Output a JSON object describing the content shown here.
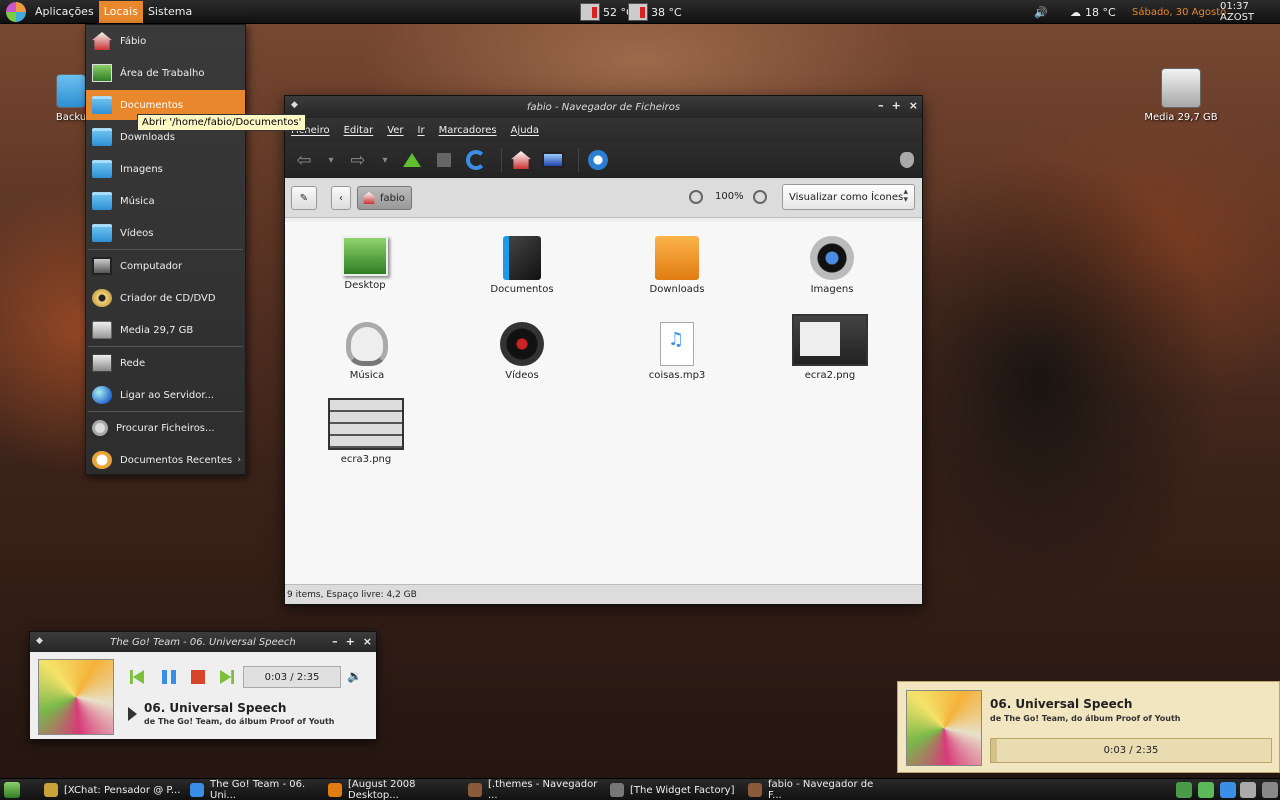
{
  "top_panel": {
    "menus": [
      "Aplicações",
      "Locais",
      "Sistema"
    ],
    "active_menu": "Locais",
    "cpu_temp": "52 °C",
    "hdd_temp": "38 °C",
    "weather": "18 °C",
    "date": "Sábado, 30 Agosto",
    "time": "01:37 AZOST"
  },
  "places_menu": {
    "items": [
      {
        "label": "Fábio",
        "icon": "home-icon"
      },
      {
        "label": "Área de Trabalho",
        "icon": "desktop-icon"
      },
      {
        "label": "Documentos",
        "icon": "folder-icon",
        "highlighted": true
      },
      {
        "label": "Downloads",
        "icon": "folder-icon"
      },
      {
        "label": "Imagens",
        "icon": "folder-icon"
      },
      {
        "label": "Música",
        "icon": "folder-icon"
      },
      {
        "label": "Vídeos",
        "icon": "folder-icon"
      },
      {
        "label": "Computador",
        "icon": "computer-icon"
      },
      {
        "label": "Criador de CD/DVD",
        "icon": "cd-icon"
      },
      {
        "label": "Media 29,7 GB",
        "icon": "drive-icon"
      },
      {
        "label": "Rede",
        "icon": "network-icon"
      },
      {
        "label": "Ligar ao Servidor...",
        "icon": "globe-icon"
      },
      {
        "label": "Procurar Ficheiros...",
        "icon": "search-icon"
      },
      {
        "label": "Documentos Recentes",
        "icon": "recent-icon",
        "submenu": true
      }
    ],
    "tooltip": "Abrir '/home/fabio/Documentos'"
  },
  "desktop_icons": {
    "left_partial": "Backu",
    "media": "Media 29,7 GB"
  },
  "file_manager": {
    "title": "fabio - Navegador de Ficheiros",
    "menubar": [
      "Ficheiro",
      "Editar",
      "Ver",
      "Ir",
      "Marcadores",
      "Ajuda"
    ],
    "location": "fabio",
    "zoom": "100%",
    "view_mode": "Visualizar como Ícones",
    "files": [
      {
        "name": "Desktop",
        "kind": "t-desk"
      },
      {
        "name": "Documentos",
        "kind": "t-docs"
      },
      {
        "name": "Downloads",
        "kind": "t-down"
      },
      {
        "name": "Imagens",
        "kind": "t-img"
      },
      {
        "name": "Música",
        "kind": "t-music"
      },
      {
        "name": "Vídeos",
        "kind": "t-video"
      },
      {
        "name": "coisas.mp3",
        "kind": "t-mp3"
      },
      {
        "name": "ecra2.png",
        "kind": "t-shot"
      },
      {
        "name": "ecra3.png",
        "kind": "t-shot2"
      }
    ],
    "status": "9 items, Espaço livre: 4,2 GB"
  },
  "music_player": {
    "title": "The Go! Team - 06. Universal Speech",
    "time": "0:03 / 2:35",
    "song": "06. Universal Speech",
    "subtitle": "de The Go! Team, do álbum Proof of Youth"
  },
  "notification": {
    "song": "06. Universal Speech",
    "subtitle": "de The Go! Team, do álbum Proof of Youth",
    "time": "0:03 / 2:35",
    "progress": 0.02
  },
  "taskbar": [
    {
      "label": "[XChat: Pensador @ P...",
      "color": "#c9a23a"
    },
    {
      "label": "The Go! Team - 06. Uni...",
      "color": "#3a8ee6"
    },
    {
      "label": "[August 2008 Desktop...",
      "color": "#e07c12"
    },
    {
      "label": "[.themes - Navegador ...",
      "color": "#8a5a3a"
    },
    {
      "label": "[The Widget Factory]",
      "color": "#777777"
    },
    {
      "label": "fabio - Navegador de F...",
      "color": "#8a5a3a"
    }
  ]
}
